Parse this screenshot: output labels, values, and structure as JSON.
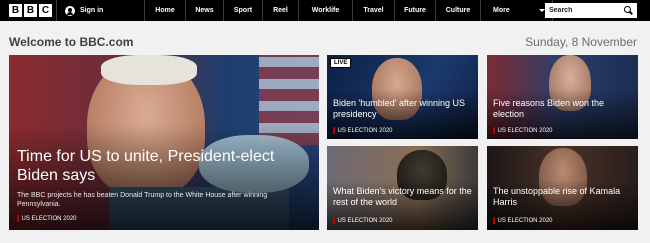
{
  "brand": {
    "logo_letters": [
      "B",
      "B",
      "C"
    ]
  },
  "header": {
    "signin_label": "Sign in",
    "nav": [
      "Home",
      "News",
      "Sport",
      "Reel",
      "Worklife",
      "Travel",
      "Future",
      "Culture"
    ],
    "more_label": "More",
    "search_placeholder": "Search"
  },
  "page": {
    "welcome": "Welcome to BBC.com",
    "date": "Sunday, 8 November"
  },
  "stories": {
    "main": {
      "headline": "Time for US to unite, President-elect Biden says",
      "summary": "The BBC projects he has beaten Donald Trump to the White House after winning Pennsylvania.",
      "tag": "US ELECTION 2020"
    },
    "s1": {
      "badge": "LIVE",
      "headline": "Biden 'humbled' after winning US presidency",
      "tag": "US ELECTION 2020"
    },
    "s2": {
      "headline": "Five reasons Biden won the election",
      "tag": "US ELECTION 2020"
    },
    "s3": {
      "headline": "What Biden's victory means for the rest of the world",
      "tag": "US ELECTION 2020"
    },
    "s4": {
      "headline": "The unstoppable rise of Kamala Harris",
      "tag": "US ELECTION 2020"
    }
  }
}
